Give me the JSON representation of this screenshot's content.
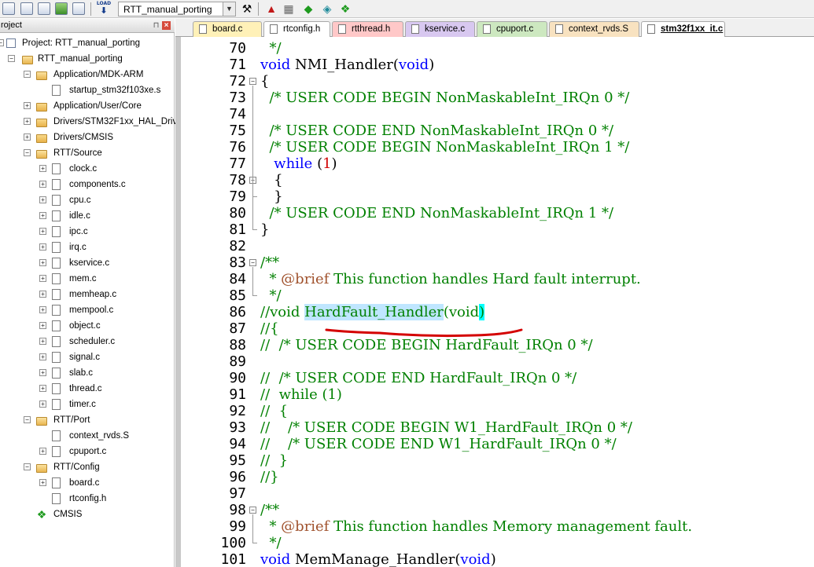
{
  "toolbar": {
    "load_label": "LOAD",
    "target_value": "RTT_manual_porting",
    "icons": [
      "copy-icon",
      "options-icon",
      "select-icon",
      "stack-icon",
      "batch-icon",
      "load-icon",
      "wizard-icon",
      "manage-icon",
      "grid-icon",
      "diamond-icon",
      "pack-icon",
      "component-icon"
    ]
  },
  "project_panel": {
    "title": "roject",
    "root": "Project: RTT_manual_porting",
    "tree": [
      {
        "label": "RTT_manual_porting",
        "type": "target",
        "level": 1,
        "expander": "-"
      },
      {
        "label": "Application/MDK-ARM",
        "type": "folder-open",
        "level": 2,
        "expander": "-"
      },
      {
        "label": "startup_stm32f103xe.s",
        "type": "file",
        "level": 3,
        "expander": ""
      },
      {
        "label": "Application/User/Core",
        "type": "folder",
        "level": 2,
        "expander": "+"
      },
      {
        "label": "Drivers/STM32F1xx_HAL_Driv",
        "type": "folder",
        "level": 2,
        "expander": "+"
      },
      {
        "label": "Drivers/CMSIS",
        "type": "folder",
        "level": 2,
        "expander": "+"
      },
      {
        "label": "RTT/Source",
        "type": "folder-open",
        "level": 2,
        "expander": "-"
      },
      {
        "label": "clock.c",
        "type": "file",
        "level": 3,
        "expander": "+"
      },
      {
        "label": "components.c",
        "type": "file",
        "level": 3,
        "expander": "+"
      },
      {
        "label": "cpu.c",
        "type": "file",
        "level": 3,
        "expander": "+"
      },
      {
        "label": "idle.c",
        "type": "file",
        "level": 3,
        "expander": "+"
      },
      {
        "label": "ipc.c",
        "type": "file",
        "level": 3,
        "expander": "+"
      },
      {
        "label": "irq.c",
        "type": "file",
        "level": 3,
        "expander": "+"
      },
      {
        "label": "kservice.c",
        "type": "file",
        "level": 3,
        "expander": "+"
      },
      {
        "label": "mem.c",
        "type": "file",
        "level": 3,
        "expander": "+"
      },
      {
        "label": "memheap.c",
        "type": "file",
        "level": 3,
        "expander": "+"
      },
      {
        "label": "mempool.c",
        "type": "file",
        "level": 3,
        "expander": "+"
      },
      {
        "label": "object.c",
        "type": "file",
        "level": 3,
        "expander": "+"
      },
      {
        "label": "scheduler.c",
        "type": "file",
        "level": 3,
        "expander": "+"
      },
      {
        "label": "signal.c",
        "type": "file",
        "level": 3,
        "expander": "+"
      },
      {
        "label": "slab.c",
        "type": "file",
        "level": 3,
        "expander": "+"
      },
      {
        "label": "thread.c",
        "type": "file",
        "level": 3,
        "expander": "+"
      },
      {
        "label": "timer.c",
        "type": "file",
        "level": 3,
        "expander": "+"
      },
      {
        "label": "RTT/Port",
        "type": "folder-open",
        "level": 2,
        "expander": "-"
      },
      {
        "label": "context_rvds.S",
        "type": "file",
        "level": 3,
        "expander": ""
      },
      {
        "label": "cpuport.c",
        "type": "file",
        "level": 3,
        "expander": "+"
      },
      {
        "label": "RTT/Config",
        "type": "folder-open",
        "level": 2,
        "expander": "-"
      },
      {
        "label": "board.c",
        "type": "file",
        "level": 3,
        "expander": "+"
      },
      {
        "label": "rtconfig.h",
        "type": "file",
        "level": 3,
        "expander": ""
      },
      {
        "label": "CMSIS",
        "type": "cmsis",
        "level": 2,
        "expander": ""
      }
    ]
  },
  "tabs": [
    {
      "label": "board.c",
      "color": "#fff1b8",
      "active": false
    },
    {
      "label": "rtconfig.h",
      "color": "#ffffff",
      "active": false
    },
    {
      "label": "rtthread.h",
      "color": "#ffc8c8",
      "active": false
    },
    {
      "label": "kservice.c",
      "color": "#d8c8f0",
      "active": false
    },
    {
      "label": "cpuport.c",
      "color": "#cde8c0",
      "active": false
    },
    {
      "label": "context_rvds.S",
      "color": "#f8e2c0",
      "active": false
    },
    {
      "label": "stm32f1xx_it.c",
      "color": "#ffffff",
      "active": true
    }
  ],
  "editor": {
    "lines": [
      {
        "num": "70",
        "fold": "",
        "segs": [
          {
            "t": "  */",
            "c": "cm"
          }
        ]
      },
      {
        "num": "71",
        "fold": "",
        "segs": [
          {
            "t": "void",
            "c": "kw"
          },
          {
            "t": " NMI_Handler(",
            "c": ""
          },
          {
            "t": "void",
            "c": "kw"
          },
          {
            "t": ")",
            "c": ""
          }
        ]
      },
      {
        "num": "72",
        "fold": "-",
        "segs": [
          {
            "t": "{",
            "c": ""
          }
        ]
      },
      {
        "num": "73",
        "fold": "",
        "segs": [
          {
            "t": "  /* USER CODE BEGIN NonMaskableInt_IRQn 0 */",
            "c": "cm"
          }
        ]
      },
      {
        "num": "74",
        "fold": "",
        "segs": []
      },
      {
        "num": "75",
        "fold": "",
        "segs": [
          {
            "t": "  /* USER CODE END NonMaskableInt_IRQn 0 */",
            "c": "cm"
          }
        ]
      },
      {
        "num": "76",
        "fold": "",
        "segs": [
          {
            "t": "  /* USER CODE BEGIN NonMaskableInt_IRQn 1 */",
            "c": "cm"
          }
        ]
      },
      {
        "num": "77",
        "fold": "",
        "segs": [
          {
            "t": "   ",
            "c": ""
          },
          {
            "t": "while",
            "c": "kw"
          },
          {
            "t": " (",
            "c": ""
          },
          {
            "t": "1",
            "c": "num"
          },
          {
            "t": ")",
            "c": ""
          }
        ]
      },
      {
        "num": "78",
        "fold": "-",
        "segs": [
          {
            "t": "   {",
            "c": ""
          }
        ]
      },
      {
        "num": "79",
        "fold": "",
        "segs": [
          {
            "t": "   }",
            "c": ""
          }
        ]
      },
      {
        "num": "80",
        "fold": "",
        "segs": [
          {
            "t": "  /* USER CODE END NonMaskableInt_IRQn 1 */",
            "c": "cm"
          }
        ]
      },
      {
        "num": "81",
        "fold": "",
        "segs": [
          {
            "t": "}",
            "c": ""
          }
        ]
      },
      {
        "num": "82",
        "fold": "",
        "segs": []
      },
      {
        "num": "83",
        "fold": "-",
        "segs": [
          {
            "t": "/**",
            "c": "cm"
          }
        ]
      },
      {
        "num": "84",
        "fold": "",
        "segs": [
          {
            "t": "  * ",
            "c": "cm"
          },
          {
            "t": "@brief",
            "c": "doc"
          },
          {
            "t": " This function handles Hard fault interrupt.",
            "c": "cm"
          }
        ]
      },
      {
        "num": "85",
        "fold": "",
        "segs": [
          {
            "t": "  */",
            "c": "cm"
          }
        ]
      },
      {
        "num": "86",
        "fold": "",
        "segs": [
          {
            "t": "//void ",
            "c": "cm"
          },
          {
            "t": "HardFault_Handler",
            "c": "cm hl"
          },
          {
            "t": "(void",
            "c": "cm"
          },
          {
            "t": ")",
            "c": "cm hl2"
          }
        ]
      },
      {
        "num": "87",
        "fold": "",
        "segs": [
          {
            "t": "//{",
            "c": "cm"
          }
        ]
      },
      {
        "num": "88",
        "fold": "",
        "segs": [
          {
            "t": "//  /* USER CODE BEGIN HardFault_IRQn 0 */",
            "c": "cm"
          }
        ]
      },
      {
        "num": "89",
        "fold": "",
        "segs": []
      },
      {
        "num": "90",
        "fold": "",
        "segs": [
          {
            "t": "//  /* USER CODE END HardFault_IRQn 0 */",
            "c": "cm"
          }
        ]
      },
      {
        "num": "91",
        "fold": "",
        "segs": [
          {
            "t": "//  while (1)",
            "c": "cm"
          }
        ]
      },
      {
        "num": "92",
        "fold": "",
        "segs": [
          {
            "t": "//  {",
            "c": "cm"
          }
        ]
      },
      {
        "num": "93",
        "fold": "",
        "segs": [
          {
            "t": "//    /* USER CODE BEGIN W1_HardFault_IRQn 0 */",
            "c": "cm"
          }
        ]
      },
      {
        "num": "94",
        "fold": "",
        "segs": [
          {
            "t": "//    /* USER CODE END W1_HardFault_IRQn 0 */",
            "c": "cm"
          }
        ]
      },
      {
        "num": "95",
        "fold": "",
        "segs": [
          {
            "t": "//  }",
            "c": "cm"
          }
        ]
      },
      {
        "num": "96",
        "fold": "",
        "segs": [
          {
            "t": "//}",
            "c": "cm"
          }
        ]
      },
      {
        "num": "97",
        "fold": "",
        "segs": []
      },
      {
        "num": "98",
        "fold": "-",
        "segs": [
          {
            "t": "/**",
            "c": "cm"
          }
        ]
      },
      {
        "num": "99",
        "fold": "",
        "segs": [
          {
            "t": "  * ",
            "c": "cm"
          },
          {
            "t": "@brief",
            "c": "doc"
          },
          {
            "t": " This function handles Memory management fault.",
            "c": "cm"
          }
        ]
      },
      {
        "num": "100",
        "fold": "",
        "segs": [
          {
            "t": "  */",
            "c": "cm"
          }
        ]
      },
      {
        "num": "101",
        "fold": "",
        "segs": [
          {
            "t": "void",
            "c": "kw"
          },
          {
            "t": " MemManage_Handler(",
            "c": ""
          },
          {
            "t": "void",
            "c": "kw"
          },
          {
            "t": ")",
            "c": ""
          }
        ]
      }
    ]
  },
  "colors": {
    "keyword": "#0000ff",
    "comment": "#008000",
    "number": "#d00000",
    "doc_tag": "#a0522d",
    "selection": "#bfe6ff",
    "brace_match": "#00ffff",
    "annotation": "#d40000"
  }
}
